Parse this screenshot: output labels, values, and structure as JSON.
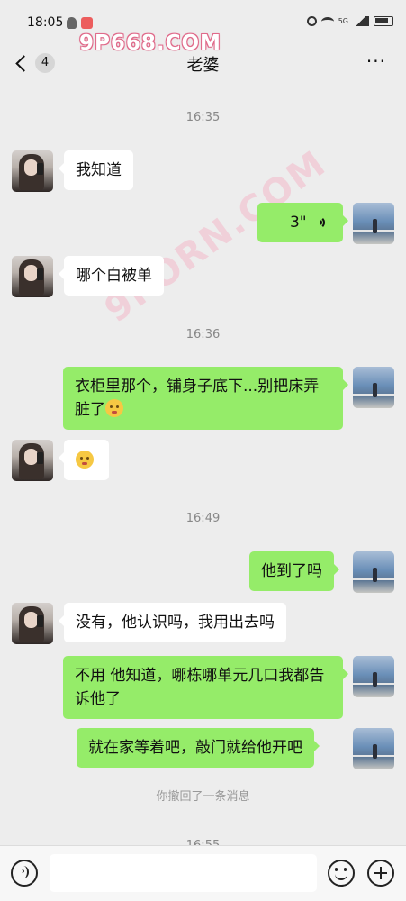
{
  "status_bar": {
    "time": "18:05",
    "network": "5G",
    "icons": [
      "qq-icon",
      "app-icon",
      "alarm-icon",
      "wifi-icon",
      "signal-icon",
      "battery-icon"
    ]
  },
  "watermark": {
    "top_text": "9P668.COM",
    "diagonal_text": "9PORN.COM"
  },
  "header": {
    "back_icon": "chevron-left-icon",
    "unread_count": "4",
    "title": "老婆",
    "more_icon": "more-icon",
    "more_label": "···"
  },
  "messages": {
    "ts1": "16:35",
    "m1": "我知道",
    "m2_duration": "3\"",
    "m2_icon": "voice-wave-icon",
    "m3": "哪个白被单",
    "ts2": "16:36",
    "m4_text": "衣柜里那个，铺身子底下...别把床弄脏了",
    "m4_emoji": "kissing-face-emoji",
    "m5_emoji": "pleading-face-emoji",
    "ts3": "16:49",
    "m6": "他到了吗",
    "m7": "没有，他认识吗，我用出去吗",
    "m8": "不用 他知道，哪栋哪单元几口我都告诉他了",
    "m9": "就在家等着吧，敲门就给他开吧",
    "recall": "你撤回了一条消息",
    "ts4": "16:55"
  },
  "input_bar": {
    "voice_icon": "voice-input-icon",
    "text_value": "",
    "emoji_icon": "emoji-icon",
    "plus_icon": "plus-icon"
  },
  "colors": {
    "background": "#ededed",
    "bubble_self": "#95ec69",
    "bubble_other": "#ffffff",
    "timestamp": "#888888"
  }
}
